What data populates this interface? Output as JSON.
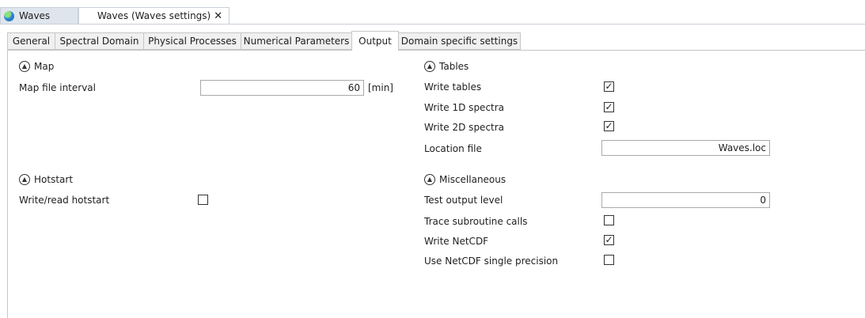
{
  "doc_tabs": {
    "first": {
      "label": "Waves",
      "icon": "globe-icon"
    },
    "second": {
      "label": "Waves (Waves settings)",
      "close": "✕"
    }
  },
  "settings_tabs": [
    "General",
    "Spectral Domain",
    "Physical Processes",
    "Numerical Parameters",
    "Output",
    "Domain specific settings"
  ],
  "active_tab": "Output",
  "map": {
    "title": "Map",
    "interval_label": "Map file interval",
    "interval_value": "60",
    "interval_unit": "[min]"
  },
  "hotstart": {
    "title": "Hotstart",
    "write_read_label": "Write/read hotstart",
    "write_read_checked": false
  },
  "tables": {
    "title": "Tables",
    "write_tables_label": "Write tables",
    "write_tables_checked": true,
    "write_1d_label": "Write 1D spectra",
    "write_1d_checked": true,
    "write_2d_label": "Write 2D spectra",
    "write_2d_checked": true,
    "location_label": "Location file",
    "location_value": "Waves.loc"
  },
  "misc": {
    "title": "Miscellaneous",
    "test_output_label": "Test output level",
    "test_output_value": "0",
    "trace_label": "Trace subroutine calls",
    "trace_checked": false,
    "netcdf_label": "Write NetCDF",
    "netcdf_checked": true,
    "netcdf_single_label": "Use NetCDF single precision",
    "netcdf_single_checked": false
  },
  "colors": {
    "tab_border": "#c6c6c6",
    "tab_bg": "#f0f0f0",
    "doc_tab_bg": "#dfe5ed"
  }
}
